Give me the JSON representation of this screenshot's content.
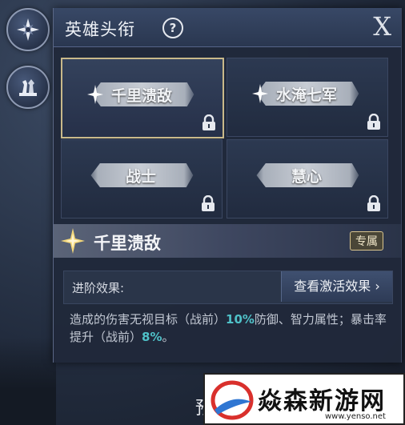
{
  "side": {
    "items": [
      {
        "icon": "compass-icon"
      },
      {
        "icon": "chess-pieces-icon"
      }
    ]
  },
  "header": {
    "title": "英雄头衔",
    "help_symbol": "?",
    "close_symbol": "X"
  },
  "titles": [
    {
      "name": "千里溃敌",
      "selected": true,
      "locked": true,
      "has_star": true
    },
    {
      "name": "水淹七军",
      "selected": false,
      "locked": true,
      "has_star": true
    },
    {
      "name": "战士",
      "selected": false,
      "locked": true,
      "has_star": false
    },
    {
      "name": "慧心",
      "selected": false,
      "locked": true,
      "has_star": false
    }
  ],
  "detail": {
    "title": "千里溃敌",
    "badge": "专属",
    "effect_label": "进阶效果:",
    "effect_button": "查看激活效果 ›",
    "desc_part1": "造成的伤害无视目标（战前）",
    "desc_value1": "10%",
    "desc_part2": "防御、智力属性；暴击率提升（战前）",
    "desc_value2": "8%",
    "desc_end": "。"
  },
  "stray_text": "预",
  "watermark": {
    "text": "焱森新游网",
    "url": "www.yenso.net"
  },
  "colors": {
    "highlight": "#4fc1c8",
    "selected_border": "#c9b98a"
  }
}
